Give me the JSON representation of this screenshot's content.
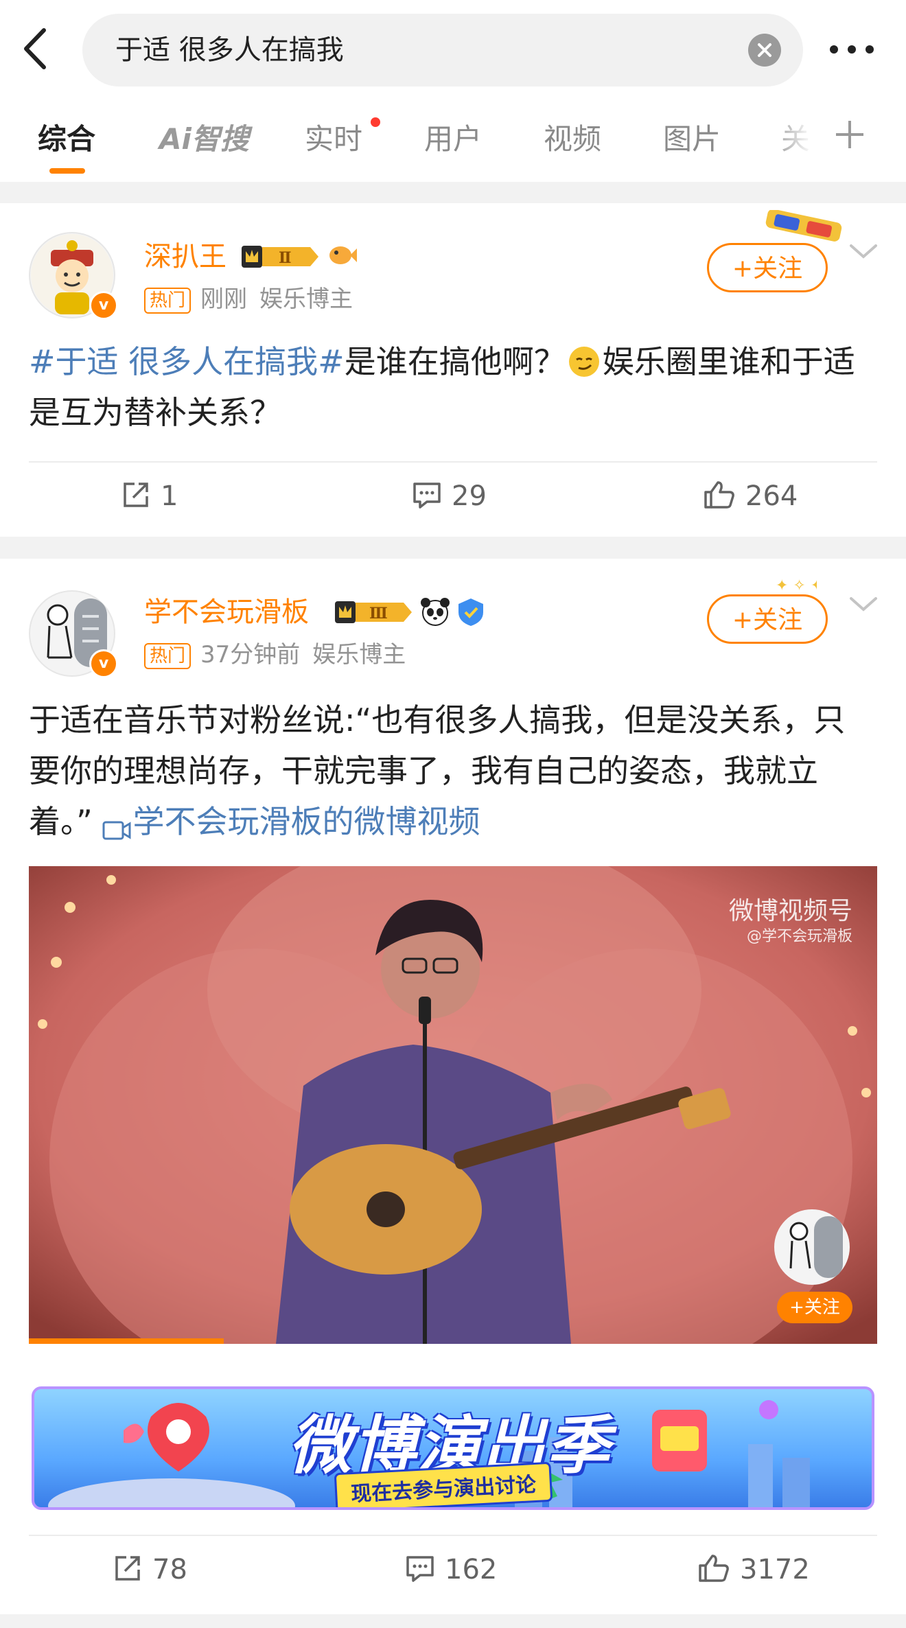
{
  "search": {
    "query": "于适 很多人在搞我"
  },
  "tabs": [
    {
      "label": "综合"
    },
    {
      "label": "Ai智搜"
    },
    {
      "label": "实时"
    },
    {
      "label": "用户"
    },
    {
      "label": "视频"
    },
    {
      "label": "图片"
    },
    {
      "label": "关"
    }
  ],
  "posts": [
    {
      "username": "深扒王",
      "level_badge": "Ⅱ",
      "hot_tag": "热门",
      "time": "刚刚",
      "identity": "娱乐博主",
      "follow_label": "+关注",
      "hashtag": "#于适 很多人在搞我#",
      "text": "是谁在搞他啊？",
      "text2": "娱乐圈里谁和于适是互为替补关系？",
      "reposts": "1",
      "comments": "29",
      "likes": "264"
    },
    {
      "username": "学不会玩滑板",
      "level_badge": "Ⅲ",
      "hot_tag": "热门",
      "time": "37分钟前",
      "identity": "娱乐博主",
      "follow_label": "+关注",
      "text": "于适在音乐节对粉丝说:“也有很多人搞我，但是没关系，只要你的理想尚存，干就完事了，我有自己的姿态，我就立着。”",
      "video_link": "学不会玩滑板的微博视频",
      "video": {
        "watermark_title": "微博视频号",
        "watermark_sub": "@学不会玩滑板",
        "follow_label": "+关注",
        "progress": 0.23
      },
      "banner": {
        "title": "微博演出季",
        "subtitle": "现在去参与演出讨论"
      },
      "reposts": "78",
      "comments": "162",
      "likes": "3172"
    }
  ],
  "colors": {
    "accent": "#ff8200",
    "link": "#4d7eb8"
  }
}
